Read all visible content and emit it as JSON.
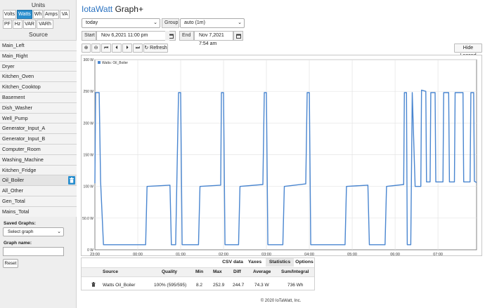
{
  "sidebar": {
    "units_heading": "Units",
    "units": [
      {
        "label": "Volts",
        "active": false
      },
      {
        "label": "Watts",
        "active": true
      },
      {
        "label": "Wh",
        "active": false
      },
      {
        "label": "Amps",
        "active": false
      },
      {
        "label": "VA",
        "active": false
      },
      {
        "label": "PF",
        "active": false
      },
      {
        "label": "Hz",
        "active": false
      },
      {
        "label": "VAR",
        "active": false
      },
      {
        "label": "VARh",
        "active": false
      }
    ],
    "source_heading": "Source",
    "sources": [
      "Main_Left",
      "Main_Right",
      "Dryer",
      "Kitchen_Oven",
      "Kitchen_Cooktop",
      "Basement",
      "Dish_Washer",
      "Well_Pump",
      "Generator_Input_A",
      "Generator_Input_B",
      "Computer_Room",
      "Washing_Machine",
      "Kitchen_Fridge",
      "Oil_Boiler",
      "All_Other",
      "Gen_Total",
      "Mains_Total"
    ],
    "selected_source": "Oil_Boiler",
    "saved_graphs_label": "Saved Graphs:",
    "select_graph_placeholder": "Select graph",
    "graph_name_label": "Graph name:",
    "graph_name_value": "",
    "reset_label": "Reset"
  },
  "header": {
    "brand": "IotaWatt",
    "title": "Graph+"
  },
  "controls": {
    "period_value": "today",
    "group_label": "Group",
    "group_value": "auto (1m)",
    "start_label": "Start",
    "start_value": "Nov 6,2021 11:00 pm",
    "end_label": "End",
    "end_value": "Nov 7,2021 7:54 am",
    "zoom_in_label": "⊕",
    "zoom_out_label": "⊖",
    "first_label": "⏮",
    "prev_label": "⏴",
    "next_label": "⏵",
    "last_label": "⏭",
    "refresh_label": "↻ Refresh",
    "hide_legend_label": "Hide Legend"
  },
  "chart_data": {
    "type": "line",
    "title": "",
    "legend": [
      "Watts: Oil_Boiler"
    ],
    "legend_position": "top-left",
    "xlabel": "",
    "ylabel": "",
    "grid": true,
    "ylim": [
      0,
      300
    ],
    "yticks": [
      "0 W",
      "50.0 W",
      "100 W",
      "150 W",
      "200 W",
      "250 W",
      "300 W"
    ],
    "xticks": [
      "23:00",
      "00:00",
      "01:00",
      "02:00",
      "03:00",
      "04:00",
      "05:00",
      "06:00",
      "07:00"
    ],
    "xlim": [
      "2021-11-06 23:00",
      "2021-11-07 07:54"
    ],
    "line_color": "#4a86d0",
    "series": [
      {
        "name": "Watts: Oil_Boiler",
        "points": [
          [
            "23:00",
            105
          ],
          [
            "23:01",
            248
          ],
          [
            "23:06",
            248
          ],
          [
            "23:08",
            108
          ],
          [
            "23:12",
            8
          ],
          [
            "00:53",
            8
          ],
          [
            "00:57",
            248
          ],
          [
            "01:00",
            248
          ],
          [
            "01:02",
            8
          ],
          [
            "00:11",
            8
          ],
          [
            "00:13",
            100
          ],
          [
            "00:45",
            102
          ],
          [
            "00:47",
            8
          ],
          [
            "01:25",
            8
          ],
          [
            "01:27",
            100
          ],
          [
            "01:56",
            102
          ],
          [
            "01:57",
            248
          ],
          [
            "02:00",
            248
          ],
          [
            "02:02",
            8
          ],
          [
            "02:21",
            8
          ],
          [
            "02:23",
            100
          ],
          [
            "02:55",
            103
          ],
          [
            "02:57",
            248
          ],
          [
            "03:00",
            248
          ],
          [
            "03:02",
            8
          ],
          [
            "03:23",
            8
          ],
          [
            "03:25",
            100
          ],
          [
            "03:55",
            104
          ],
          [
            "03:57",
            248
          ],
          [
            "04:00",
            248
          ],
          [
            "04:02",
            8
          ],
          [
            "04:50",
            8
          ],
          [
            "04:52",
            100
          ],
          [
            "05:22",
            102
          ],
          [
            "05:24",
            8
          ],
          [
            "05:46",
            8
          ],
          [
            "05:48",
            100
          ],
          [
            "06:12",
            103
          ],
          [
            "06:13",
            248
          ],
          [
            "06:16",
            248
          ],
          [
            "06:17",
            8
          ],
          [
            "06:22",
            8
          ],
          [
            "06:24",
            248
          ],
          [
            "06:28",
            100
          ],
          [
            "06:36",
            100
          ],
          [
            "06:37",
            252
          ],
          [
            "06:43",
            250
          ],
          [
            "06:44",
            107
          ],
          [
            "06:49",
            107
          ],
          [
            "06:50",
            248
          ],
          [
            "06:56",
            248
          ],
          [
            "06:57",
            107
          ],
          [
            "07:07",
            107
          ],
          [
            "07:08",
            248
          ],
          [
            "07:15",
            248
          ],
          [
            "07:16",
            107
          ],
          [
            "07:23",
            107
          ],
          [
            "07:24",
            248
          ],
          [
            "07:35",
            248
          ],
          [
            "07:36",
            107
          ],
          [
            "07:45",
            107
          ],
          [
            "07:46",
            248
          ],
          [
            "07:50",
            248
          ],
          [
            "07:51",
            108
          ],
          [
            "07:54",
            106
          ]
        ]
      }
    ]
  },
  "stats": {
    "tabs": [
      {
        "label": "CSV data",
        "active": false
      },
      {
        "label": "Yaxes",
        "active": false
      },
      {
        "label": "Statistics",
        "active": true
      },
      {
        "label": "Options",
        "active": false
      }
    ],
    "columns": [
      "Source",
      "Quality",
      "Min",
      "Max",
      "Diff",
      "Average",
      "Sum/Integral"
    ],
    "row": {
      "source": "Watts Oil_Boiler",
      "quality": "100% (595/595)",
      "min": "8.2",
      "max": "252.9",
      "diff": "244.7",
      "average": "74.3 W",
      "sum": "736 Wh"
    }
  },
  "footer": "© 2020 IoTaWatt, Inc."
}
